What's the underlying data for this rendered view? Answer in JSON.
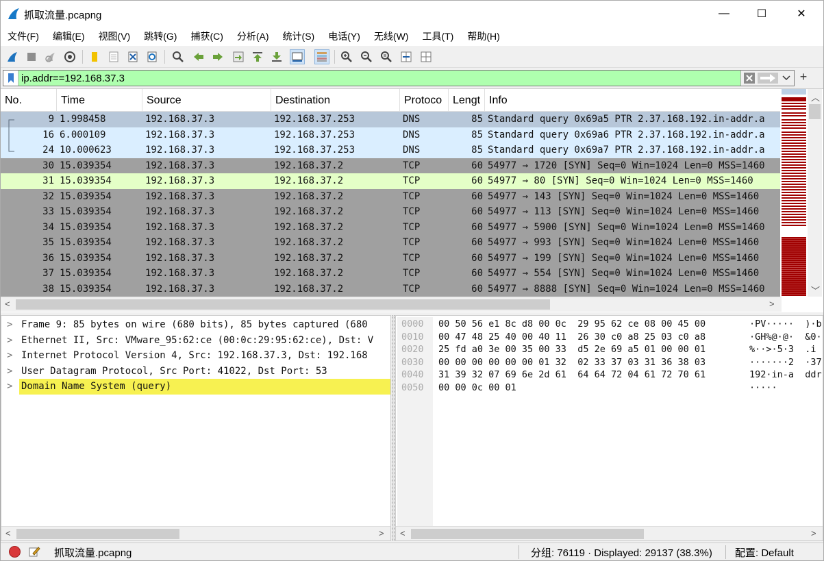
{
  "window": {
    "title": "抓取流量.pcapng",
    "controls": {
      "minimize": "—",
      "maximize": "☐",
      "close": "✕"
    }
  },
  "menu": [
    "文件(F)",
    "编辑(E)",
    "视图(V)",
    "跳转(G)",
    "捕获(C)",
    "分析(A)",
    "统计(S)",
    "电话(Y)",
    "无线(W)",
    "工具(T)",
    "帮助(H)"
  ],
  "toolbar": {
    "icons": [
      "start-capture-icon",
      "stop-capture-icon",
      "restart-capture-icon",
      "capture-options-icon",
      "open-file-icon",
      "save-file-icon",
      "close-file-icon",
      "reload-icon",
      "find-packet-icon",
      "go-back-icon",
      "go-forward-icon",
      "go-to-packet-icon",
      "go-first-icon",
      "go-last-icon",
      "auto-scroll-icon",
      "colorize-icon",
      "zoom-in-icon",
      "zoom-out-icon",
      "zoom-normal-icon",
      "resize-columns-icon",
      "layout-icon"
    ]
  },
  "filter": {
    "value": "ip.addr==192.168.37.3",
    "bg_color": "#afffaf"
  },
  "packet_list": {
    "columns": [
      "No.",
      "Time",
      "Source",
      "Destination",
      "Protoco",
      "Lengt",
      "Info"
    ],
    "rows": [
      {
        "no": "9",
        "time": "1.998458",
        "src": "192.168.37.3",
        "dst": "192.168.37.253",
        "proto": "DNS",
        "len": "85",
        "info": "Standard query 0x69a5 PTR 2.37.168.192.in-addr.a",
        "bg": "#b7c7d9"
      },
      {
        "no": "16",
        "time": "6.000109",
        "src": "192.168.37.3",
        "dst": "192.168.37.253",
        "proto": "DNS",
        "len": "85",
        "info": "Standard query 0x69a6 PTR 2.37.168.192.in-addr.a",
        "bg": "#daeeff"
      },
      {
        "no": "24",
        "time": "10.000623",
        "src": "192.168.37.3",
        "dst": "192.168.37.253",
        "proto": "DNS",
        "len": "85",
        "info": "Standard query 0x69a7 PTR 2.37.168.192.in-addr.a",
        "bg": "#daeeff"
      },
      {
        "no": "30",
        "time": "15.039354",
        "src": "192.168.37.3",
        "dst": "192.168.37.2",
        "proto": "TCP",
        "len": "60",
        "info": "54977 → 1720 [SYN] Seq=0 Win=1024 Len=0 MSS=1460",
        "bg": "#a0a0a0"
      },
      {
        "no": "31",
        "time": "15.039354",
        "src": "192.168.37.3",
        "dst": "192.168.37.2",
        "proto": "TCP",
        "len": "60",
        "info": "54977 → 80 [SYN] Seq=0 Win=1024 Len=0 MSS=1460",
        "bg": "#e4ffc7"
      },
      {
        "no": "32",
        "time": "15.039354",
        "src": "192.168.37.3",
        "dst": "192.168.37.2",
        "proto": "TCP",
        "len": "60",
        "info": "54977 → 143 [SYN] Seq=0 Win=1024 Len=0 MSS=1460",
        "bg": "#a0a0a0"
      },
      {
        "no": "33",
        "time": "15.039354",
        "src": "192.168.37.3",
        "dst": "192.168.37.2",
        "proto": "TCP",
        "len": "60",
        "info": "54977 → 113 [SYN] Seq=0 Win=1024 Len=0 MSS=1460",
        "bg": "#a0a0a0"
      },
      {
        "no": "34",
        "time": "15.039354",
        "src": "192.168.37.3",
        "dst": "192.168.37.2",
        "proto": "TCP",
        "len": "60",
        "info": "54977 → 5900 [SYN] Seq=0 Win=1024 Len=0 MSS=1460",
        "bg": "#a0a0a0"
      },
      {
        "no": "35",
        "time": "15.039354",
        "src": "192.168.37.3",
        "dst": "192.168.37.2",
        "proto": "TCP",
        "len": "60",
        "info": "54977 → 993 [SYN] Seq=0 Win=1024 Len=0 MSS=1460",
        "bg": "#a0a0a0"
      },
      {
        "no": "36",
        "time": "15.039354",
        "src": "192.168.37.3",
        "dst": "192.168.37.2",
        "proto": "TCP",
        "len": "60",
        "info": "54977 → 199 [SYN] Seq=0 Win=1024 Len=0 MSS=1460",
        "bg": "#a0a0a0"
      },
      {
        "no": "37",
        "time": "15.039354",
        "src": "192.168.37.3",
        "dst": "192.168.37.2",
        "proto": "TCP",
        "len": "60",
        "info": "54977 → 554 [SYN] Seq=0 Win=1024 Len=0 MSS=1460",
        "bg": "#a0a0a0"
      },
      {
        "no": "38",
        "time": "15.039354",
        "src": "192.168.37.3",
        "dst": "192.168.37.2",
        "proto": "TCP",
        "len": "60",
        "info": "54977 → 8888 [SYN] Seq=0 Win=1024 Len=0 MSS=1460",
        "bg": "#a0a0a0"
      }
    ]
  },
  "details": [
    {
      "text": "Frame 9: 85 bytes on wire (680 bits), 85 bytes captured (680",
      "selected": false
    },
    {
      "text": "Ethernet II, Src: VMware_95:62:ce (00:0c:29:95:62:ce), Dst: V",
      "selected": false
    },
    {
      "text": "Internet Protocol Version 4, Src: 192.168.37.3, Dst: 192.168",
      "selected": false
    },
    {
      "text": "User Datagram Protocol, Src Port: 41022, Dst Port: 53",
      "selected": false
    },
    {
      "text": "Domain Name System (query)",
      "selected": true
    }
  ],
  "bytes": [
    {
      "off": "0000",
      "hex": "00 50 56 e1 8c d8 00 0c  29 95 62 ce 08 00 45 00",
      "ascii": "·PV·····  )·b"
    },
    {
      "off": "0010",
      "hex": "00 47 48 25 40 00 40 11  26 30 c0 a8 25 03 c0 a8",
      "ascii": "·GH%@·@·  &0·"
    },
    {
      "off": "0020",
      "hex": "25 fd a0 3e 00 35 00 33  d5 2e 69 a5 01 00 00 01",
      "ascii": "%··>·5·3  .i"
    },
    {
      "off": "0030",
      "hex": "00 00 00 00 00 00 01 32  02 33 37 03 31 36 38 03",
      "ascii": "·······2  ·37"
    },
    {
      "off": "0040",
      "hex": "31 39 32 07 69 6e 2d 61  64 64 72 04 61 72 70 61",
      "ascii": "192·in-a  ddr"
    },
    {
      "off": "0050",
      "hex": "00 00 0c 00 01",
      "ascii": "·····"
    }
  ],
  "status": {
    "file": "抓取流量.pcapng",
    "packets": "分组: 76119 · Displayed: 29137 (38.3%)",
    "profile": "配置: Default"
  }
}
